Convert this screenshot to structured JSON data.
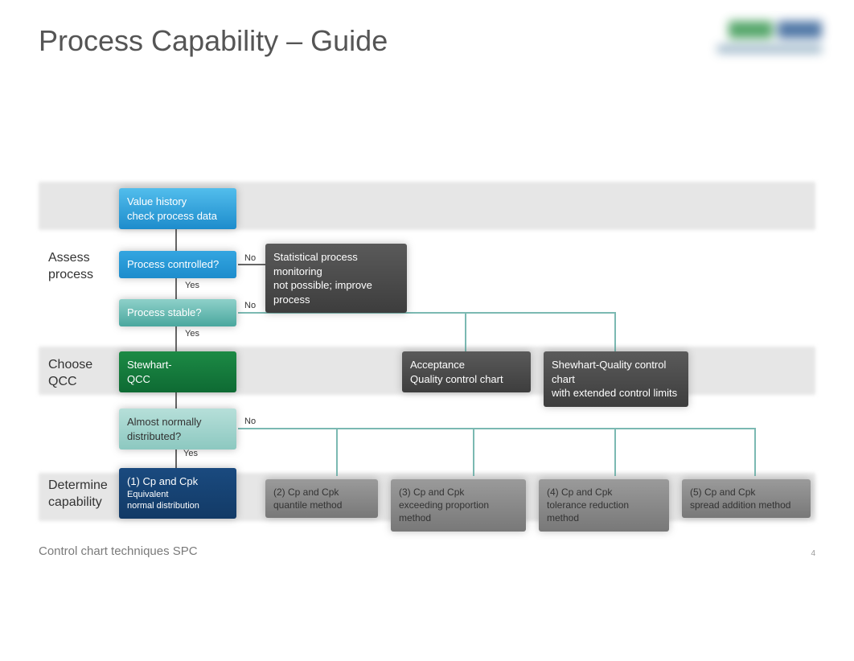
{
  "title": "Process Capability – Guide",
  "footer": "Control chart techniques SPC",
  "page": "4",
  "labels": {
    "assess": "Assess\nprocess",
    "choose": "Choose\nQCC",
    "determine": "Determine\ncapability",
    "yes": "Yes",
    "no": "No"
  },
  "boxes": {
    "valueHistory": "Value history\ncheck process data",
    "controlled": "Process controlled?",
    "stable": "Process stable?",
    "notPossible": "Statistical process monitoring\nnot possible; improve process",
    "stewhart": "Stewhart-\nQCC",
    "acceptance": "Acceptance\nQuality control chart",
    "shewhartExt": "Shewhart-Quality control chart\nwith extended control limits",
    "almost": "Almost normally\ndistributed?",
    "m1_t": "(1) Cp and Cpk",
    "m1_s": "Equivalent\nnormal distribution",
    "m2_t": "(2) Cp and Cpk",
    "m2_s": "quantile method",
    "m3_t": "(3) Cp and Cpk",
    "m3_s": "exceeding proportion method",
    "m4_t": "(4) Cp and Cpk",
    "m4_s": "tolerance reduction method",
    "m5_t": "(5) Cp and Cpk",
    "m5_s": "spread addition method"
  }
}
